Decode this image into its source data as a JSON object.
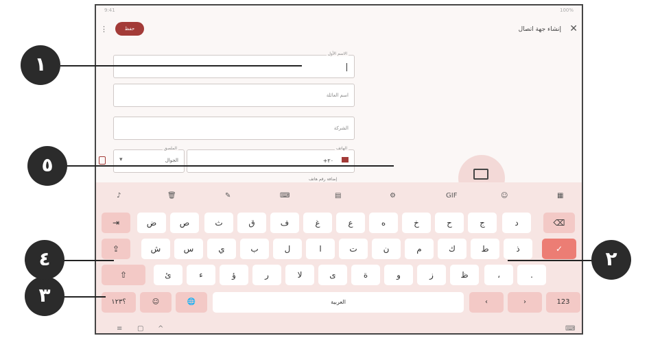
{
  "status_bar": {
    "left": "9:41",
    "right": "100%"
  },
  "header": {
    "title": "إنشاء جهة اتصال",
    "save_label": "حفظ",
    "close_glyph": "✕",
    "menu_glyph": "⋮"
  },
  "form": {
    "first_name": "الاسم الأول",
    "last_name": "اسم العائلة",
    "company": "الشركة",
    "phone_label": "الهاتف",
    "phone_value": "+٢٠",
    "label_caption": "الملصق",
    "label_value": "الجوال",
    "more_fields": "إضافة رقم هاتف"
  },
  "keyboard": {
    "toolbar": [
      "♪",
      "🗑",
      "✎",
      "⌨",
      "▤",
      "⚙",
      "GIF",
      "☺",
      "▦"
    ],
    "row1": [
      "⇥",
      "ض",
      "ص",
      "ث",
      "ق",
      "ف",
      "غ",
      "ع",
      "ه",
      "خ",
      "ح",
      "ج",
      "د",
      "⌫"
    ],
    "row2": [
      "⇪",
      "ش",
      "س",
      "ي",
      "ب",
      "ل",
      "ا",
      "ت",
      "ن",
      "م",
      "ك",
      "ط",
      "ذ",
      "✓"
    ],
    "row3": [
      "⇧",
      "ئ",
      "ء",
      "ؤ",
      "ر",
      "لا",
      "ى",
      "ة",
      "و",
      "ز",
      "ظ",
      "،",
      "."
    ],
    "row4": [
      "؟١٢٣",
      "☺",
      "🌐",
      "العربية",
      "‹",
      "›",
      "123"
    ],
    "nav": [
      "≡",
      "▢",
      "^",
      "⌨"
    ]
  },
  "callouts": [
    "١",
    "٢",
    "٣",
    "٤",
    "٥"
  ]
}
